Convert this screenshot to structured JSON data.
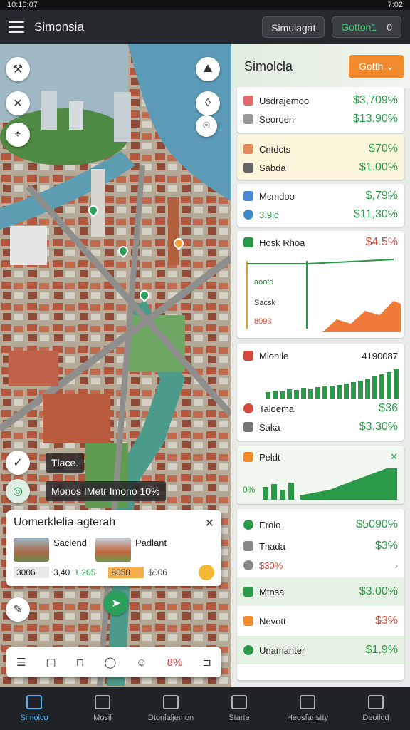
{
  "status": {
    "left": "10:16:07",
    "right": "7:02"
  },
  "app": {
    "title": "Simonsia",
    "sim_button": "Simulagat",
    "sim_status": "Gotton1",
    "sim_count": "0"
  },
  "map": {
    "tooltip1": "Tlace.",
    "tooltip2": "Monos IMetr Imono 10%",
    "card": {
      "title": "Uomerklelia agterah",
      "item1": {
        "name": "Saclend",
        "price1": "3006",
        "price2": "3,40",
        "price3": "1.205"
      },
      "item2": {
        "name": "Padlant",
        "price1": "8058",
        "price2": "$006"
      }
    },
    "toolbar": {
      "pct": "8%"
    }
  },
  "panel": {
    "title": "Simolcla",
    "button": "Gotth",
    "g1": [
      {
        "label": "Usdrajemoo",
        "value": "$3,709%"
      },
      {
        "label": "Seoroen",
        "value": "$13.90%"
      }
    ],
    "g2": [
      {
        "label": "Cntdcts",
        "value": "$70%"
      },
      {
        "label": "Sabda",
        "value": "$1.00%"
      }
    ],
    "g3": [
      {
        "label": "Mcmdoo",
        "value": "$,79%"
      },
      {
        "label": "3.9lc",
        "value": "$11,30%"
      }
    ],
    "chart1": {
      "title": "Hosk Rhoa",
      "value": "$4.5%",
      "l1": "aootd",
      "l2": "Sacsk",
      "l3": "8093"
    },
    "chart2": {
      "title": "Mionile",
      "value": "4190087"
    },
    "g4": [
      {
        "label": "Taldema",
        "value": "$36"
      },
      {
        "label": "Saka",
        "value": "$3.30%"
      }
    ],
    "chart3": {
      "title": "Peldt",
      "label": "0%"
    },
    "g5": [
      {
        "label": "Erolo",
        "value": "$5090%"
      },
      {
        "label": "Thada",
        "value": "$3%"
      },
      {
        "label": "$30%",
        "value": ""
      }
    ],
    "g6": [
      {
        "label": "Mtnsa",
        "value": "$3.00%"
      }
    ],
    "g7": [
      {
        "label": "Nevott",
        "value": "$3%"
      }
    ],
    "g8": [
      {
        "label": "Unamanter",
        "value": "$1,9%"
      }
    ]
  },
  "nav": [
    "Simolco",
    "Mosil",
    "Dtonlaljemon",
    "Starte",
    "Heosfanstty",
    "Deoilod"
  ]
}
